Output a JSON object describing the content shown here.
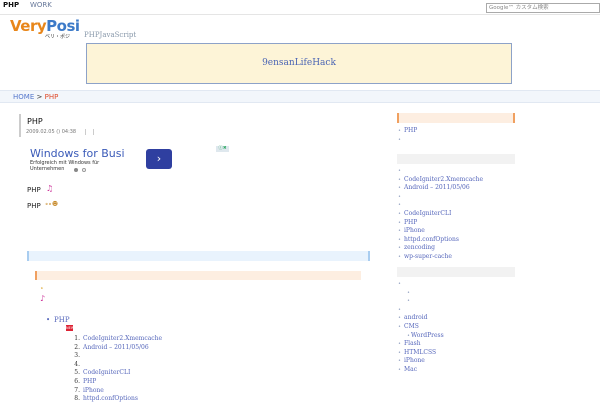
{
  "topnav": {
    "php": "PHP",
    "work": "WORK",
    "search_placeholder": "Google™ カスタム検索"
  },
  "logo": {
    "text_very": "Very",
    "text_posi": "Posi",
    "kana": "ベリ・ポジ"
  },
  "tagline": "PHPJavaScript",
  "banner": {
    "text": "9ensanLifeHack"
  },
  "breadcrumb": {
    "home": "HOME",
    "separator": ">",
    "current": "PHP"
  },
  "article": {
    "title": "PHP",
    "date": "2009.02.05 () 04:38"
  },
  "ad": {
    "title": "Windows for Business",
    "subtitle": "Erfolgreich mit Windows für Unternehmen",
    "button": "›",
    "badge": "ⓘ✖"
  },
  "tags": [
    {
      "label": "PHP",
      "icon": "music-note-icon"
    },
    {
      "label": "PHP",
      "icon": "emoji-icon"
    }
  ],
  "related": {
    "title": "PHP",
    "items": [
      {
        "num": "1.",
        "label": "CodeIgniter2.Xmemcache"
      },
      {
        "num": "2.",
        "label": "Android – 2011/05/06"
      },
      {
        "num": "3.",
        "label": ""
      },
      {
        "num": "4.",
        "label": ""
      },
      {
        "num": "5.",
        "label": "CodeIgniterCLI"
      },
      {
        "num": "6.",
        "label": "PHP"
      },
      {
        "num": "7.",
        "label": "iPhone"
      },
      {
        "num": "8.",
        "label": "httpd.confOptions"
      }
    ]
  },
  "sidebar": {
    "section1": [
      {
        "label": "PHP"
      },
      {
        "label": ""
      }
    ],
    "section2": [
      {
        "label": ""
      },
      {
        "label": "CodeIgniter2.Xmemcache"
      },
      {
        "label": "Android – 2011/05/06"
      },
      {
        "label": ""
      },
      {
        "label": ""
      },
      {
        "label": "CodeIgniterCLI"
      },
      {
        "label": "PHP"
      },
      {
        "label": "iPhone"
      },
      {
        "label": "httpd.confOptions"
      },
      {
        "label": "zencoding"
      },
      {
        "label": "wp-super-cache"
      }
    ],
    "section3": [
      {
        "label": "",
        "indent": false
      },
      {
        "label": "",
        "indent": true
      },
      {
        "label": "",
        "indent": true
      },
      {
        "label": "",
        "indent": false
      },
      {
        "label": "android",
        "indent": false
      },
      {
        "label": "CMS",
        "indent": false
      },
      {
        "label": "WordPress",
        "indent": true
      },
      {
        "label": "Flash",
        "indent": false
      },
      {
        "label": "HTMLCSS",
        "indent": false
      },
      {
        "label": "iPhone",
        "indent": false
      },
      {
        "label": "Mac",
        "indent": false
      }
    ]
  },
  "colors": {
    "link": "#5566bb",
    "accent_orange": "#f0a060",
    "breadcrumb_current": "#e04a2a",
    "banner_bg": "#fdf4d7"
  }
}
